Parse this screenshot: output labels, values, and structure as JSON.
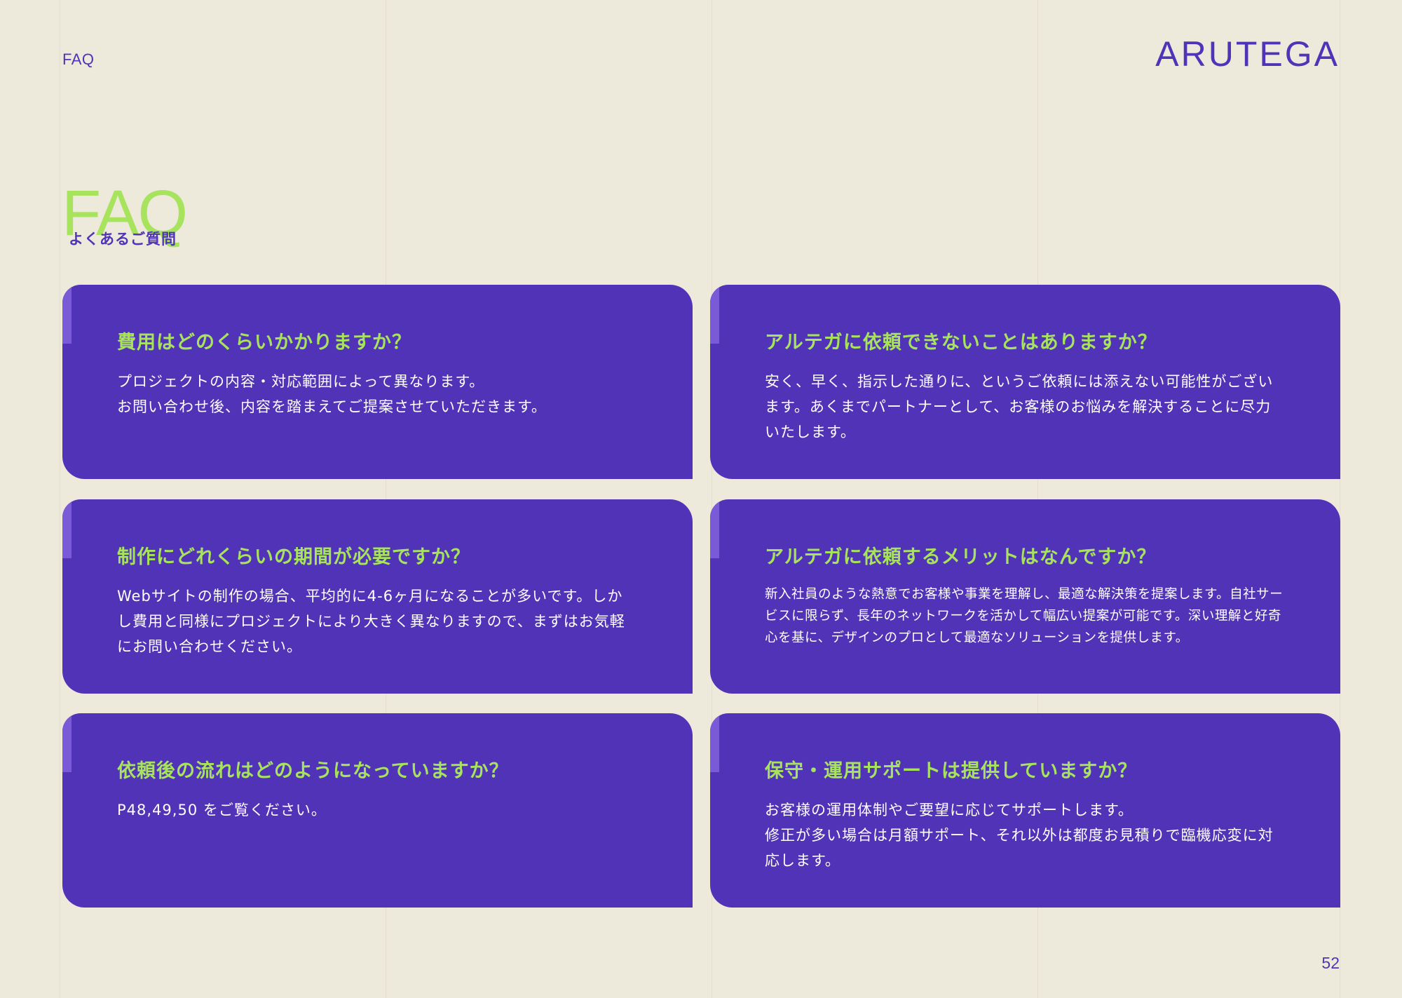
{
  "header": {
    "section_label": "FAQ",
    "brand": "ARUTEGA"
  },
  "title": {
    "en": "FAQ",
    "jp": "よくあるご質問"
  },
  "faqs": [
    {
      "question": "費用はどのくらいかかりますか？",
      "answer": "プロジェクトの内容・対応範囲によって異なります。\nお問い合わせ後、内容を踏まえてご提案させていただきます。"
    },
    {
      "question": "アルテガに依頼できないことはありますか？",
      "answer": "安く、早く、指示した通りに、というご依頼には添えない可能性がございます。あくまでパートナーとして、お客様のお悩みを解決することに尽力いたします。"
    },
    {
      "question": "制作にどれくらいの期間が必要ですか？",
      "answer": "Webサイトの制作の場合、平均的に4-6ヶ月になることが多いです。しかし費用と同様にプロジェクトにより大きく異なりますので、まずはお気軽にお問い合わせください。"
    },
    {
      "question": "アルテガに依頼するメリットはなんですか？",
      "answer": "新入社員のような熱意でお客様や事業を理解し、最適な解決策を提案します。自社サービスに限らず、長年のネットワークを活かして幅広い提案が可能です。深い理解と好奇心を基に、デザインのプロとして最適なソリューションを提供します。"
    },
    {
      "question": "依頼後の流れはどのようになっていますか？",
      "answer": "P48,49,50 をご覧ください。"
    },
    {
      "question": "保守・運用サポートは提供していますか？",
      "answer": "お客様の運用体制やご要望に応じてサポートします。\n修正が多い場合は月額サポート、それ以外は都度お見積りで臨機応変に対応します。"
    }
  ],
  "footer": {
    "page_number": "52"
  },
  "colors": {
    "background": "#eeeadb",
    "card": "#5033b6",
    "accent_green": "#a8e35e",
    "brand_purple": "#4f34b8"
  }
}
